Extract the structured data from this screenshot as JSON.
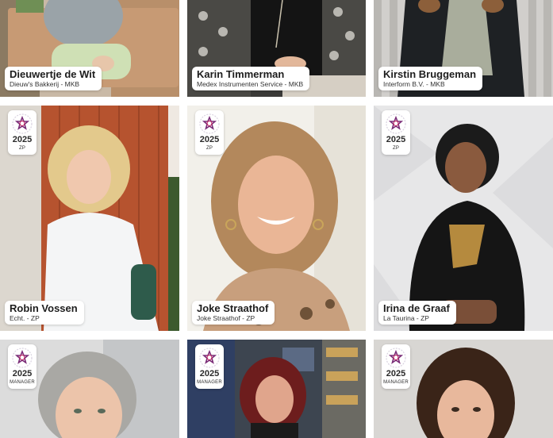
{
  "profiles": [
    {
      "name": "Dieuwertje de Wit",
      "org": "Dieuw's Bakkerij - MKB"
    },
    {
      "name": "Karin Timmerman",
      "org": "Medex Instrumenten Service - MKB"
    },
    {
      "name": "Kirstin Bruggeman",
      "org": "Interform B.V. - MKB"
    },
    {
      "name": "Robin Vossen",
      "org": "Echt. - ZP",
      "badge_year": "2025",
      "badge_category": "ZP"
    },
    {
      "name": "Joke Straathof",
      "org": "Joke Straathof - ZP",
      "badge_year": "2025",
      "badge_category": "ZP"
    },
    {
      "name": "Irina de Graaf",
      "org": "La Taurina - ZP",
      "badge_year": "2025",
      "badge_category": "ZP"
    },
    {
      "badge_year": "2025",
      "badge_category": "MANAGER"
    },
    {
      "badge_year": "2025",
      "badge_category": "MANAGER"
    },
    {
      "badge_year": "2025",
      "badge_category": "MANAGER"
    }
  ],
  "colors": {
    "badge_accent": "#7a2d78",
    "badge_accent_2": "#c0306a",
    "nameplate_bg": "#ffffff"
  },
  "icons": {
    "badge": "award-ring-icon"
  }
}
